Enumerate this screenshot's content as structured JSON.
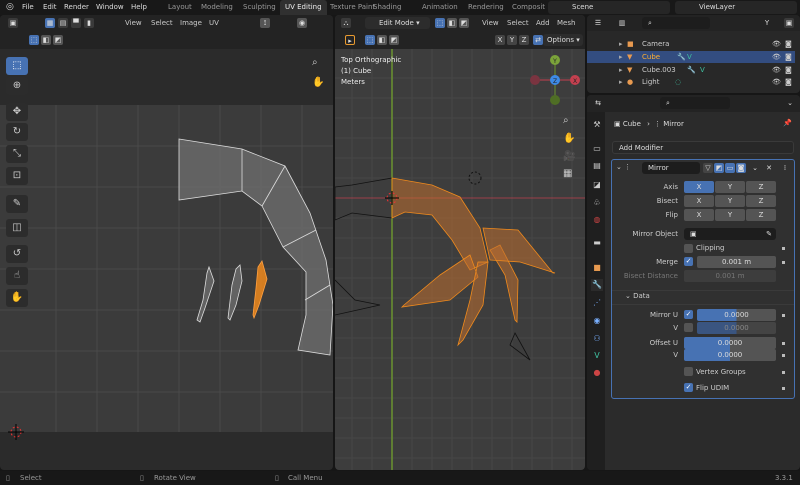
{
  "topbar": {
    "menus": [
      "File",
      "Edit",
      "Render",
      "Window",
      "Help"
    ],
    "workspaces": [
      "Layout",
      "Modeling",
      "Sculpting",
      "UV Editing",
      "Texture Paint",
      "Shading",
      "Animation",
      "Rendering",
      "Composit"
    ],
    "active_workspace": "UV Editing",
    "scene": "Scene",
    "view_layer": "ViewLayer"
  },
  "uv_editor": {
    "menus": [
      "View",
      "Select",
      "Image",
      "UV"
    ]
  },
  "viewport": {
    "mode": "Edit Mode",
    "menus": [
      "View",
      "Select",
      "Add",
      "Mesh"
    ],
    "options": "Options",
    "overlay": {
      "view": "Top Orthographic",
      "object": "(1) Cube",
      "units": "Meters"
    },
    "gizmo": {
      "y": "Y",
      "x": "X",
      "z": "Z"
    },
    "axis_colors": {
      "x": "#c4404f",
      "y": "#6b9430",
      "z": "#3d8ae6"
    },
    "accent": "#f08a1c"
  },
  "outliner": {
    "items": [
      {
        "name": "Camera",
        "icon": "camera-icon"
      },
      {
        "name": "Cube",
        "icon": "mesh-icon",
        "selected": true
      },
      {
        "name": "Cube.003",
        "icon": "mesh-icon"
      },
      {
        "name": "Light",
        "icon": "light-icon"
      }
    ]
  },
  "properties": {
    "breadcrumb": {
      "object": "Cube",
      "modifier": "Mirror"
    },
    "add_modifier": "Add Modifier",
    "modifier_name": "Mirror",
    "axis": {
      "label": "Axis",
      "x": "X",
      "y": "Y",
      "z": "Z",
      "active": "X"
    },
    "bisect": {
      "label": "Bisect",
      "x": "X",
      "y": "Y",
      "z": "Z"
    },
    "flip": {
      "label": "Flip",
      "x": "X",
      "y": "Y",
      "z": "Z"
    },
    "mirror_object": "Mirror Object",
    "clipping": "Clipping",
    "merge": {
      "label": "Merge",
      "value": "0.001 m",
      "checked": true
    },
    "bisect_distance": {
      "label": "Bisect Distance",
      "value": "0.001 m"
    },
    "data_section": "Data",
    "mirror_u": {
      "label": "Mirror U",
      "value": "0.0000",
      "checked": true
    },
    "mirror_v": {
      "label": "V",
      "value": "0.0000",
      "checked": false
    },
    "offset_u": {
      "label": "Offset U",
      "value": "0.0000"
    },
    "offset_v": {
      "label": "V",
      "value": "0.0000"
    },
    "vertex_groups": "Vertex Groups",
    "flip_udim": "Flip UDIM"
  },
  "statusbar": {
    "select": "Select",
    "rotate": "Rotate View",
    "menu": "Call Menu",
    "version": "3.3.1"
  }
}
